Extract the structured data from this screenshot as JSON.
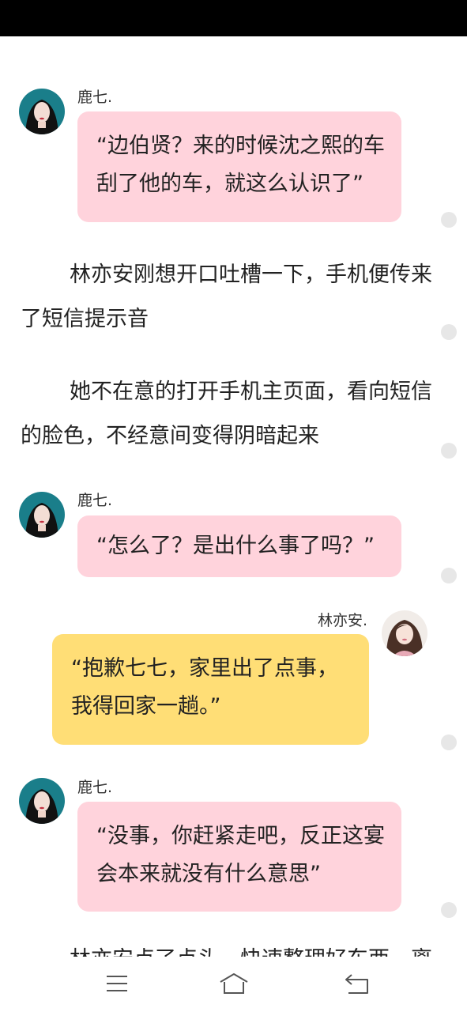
{
  "messages": {
    "m1": {
      "speaker": "鹿七.",
      "lines": [
        "“边伯贤？来的时候沈之熙的车",
        "刮了他的车，就这么认识了”"
      ]
    },
    "n1": {
      "lines": [
        "林亦安刚想开口吐槽一下，手机便传来",
        "了短信提示音"
      ]
    },
    "n2": {
      "lines": [
        "她不在意的打开手机主页面，看向短信",
        "的脸色，不经意间变得阴暗起来"
      ]
    },
    "m2": {
      "speaker": "鹿七.",
      "lines": [
        "“怎么了？是出什么事了吗？”"
      ]
    },
    "m3": {
      "speaker": "林亦安.",
      "lines": [
        "“抱歉七七，家里出了点事，",
        "我得回家一趟。”"
      ]
    },
    "m4": {
      "speaker": "鹿七.",
      "lines": [
        "“没事，你赶紧走吧，反正这宴",
        "会本来就没有什么意思”"
      ]
    },
    "n3": {
      "lines": [
        "林亦安点了点头，快速整理好东西，离"
      ]
    }
  },
  "colors": {
    "pink_bubble": "#ffd3dc",
    "yellow_bubble": "#ffde76",
    "status_bar": "#000000"
  },
  "navbar": {
    "icons": [
      "menu-icon",
      "home-icon",
      "back-icon"
    ]
  }
}
